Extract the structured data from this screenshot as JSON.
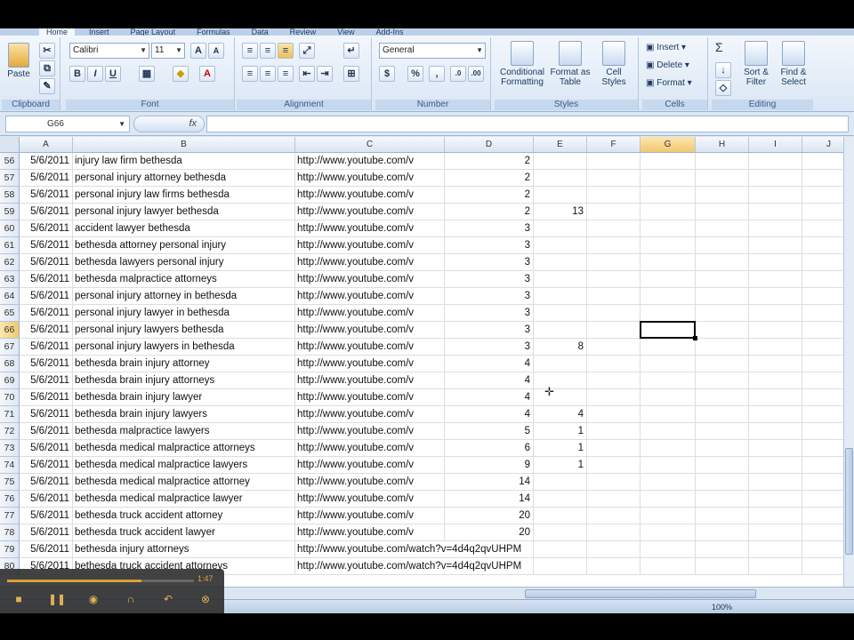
{
  "ribbon": {
    "tabs": [
      "Home",
      "Insert",
      "Page Layout",
      "Formulas",
      "Data",
      "Review",
      "View",
      "Add-Ins"
    ],
    "active_tab": "Home",
    "clipboard": {
      "paste": "Paste",
      "label": "Clipboard"
    },
    "font": {
      "name": "Calibri",
      "size": "11",
      "label": "Font",
      "bold": "B",
      "italic": "I",
      "underline": "U"
    },
    "alignment": {
      "label": "Alignment"
    },
    "number": {
      "format": "General",
      "label": "Number",
      "currency": "$",
      "percent": "%",
      "comma": ",",
      "inc_decimal": ".0",
      "dec_decimal": ".00"
    },
    "styles": {
      "conditional": "Conditional Formatting",
      "format_table": "Format as Table",
      "cell_styles": "Cell Styles",
      "label": "Styles"
    },
    "cells": {
      "insert": "Insert",
      "delete": "Delete",
      "format": "Format",
      "label": "Cells"
    },
    "editing": {
      "sum": "Σ",
      "sort_filter": "Sort & Filter",
      "find_select": "Find & Select",
      "label": "Editing"
    }
  },
  "formula_bar": {
    "name_box": "G66",
    "fx": "fx",
    "value": ""
  },
  "columns": [
    "A",
    "B",
    "C",
    "D",
    "E",
    "F",
    "G",
    "H",
    "I",
    "J"
  ],
  "selected_column": "G",
  "selected_row": "66",
  "rows": [
    {
      "n": "56",
      "a": "5/6/2011",
      "b": "injury law firm bethesda",
      "c": "http://www.youtube.com/v",
      "d": "2",
      "e": ""
    },
    {
      "n": "57",
      "a": "5/6/2011",
      "b": "personal injury attorney bethesda",
      "c": "http://www.youtube.com/v",
      "d": "2",
      "e": ""
    },
    {
      "n": "58",
      "a": "5/6/2011",
      "b": "personal injury law firms bethesda",
      "c": "http://www.youtube.com/v",
      "d": "2",
      "e": ""
    },
    {
      "n": "59",
      "a": "5/6/2011",
      "b": "personal injury lawyer bethesda",
      "c": "http://www.youtube.com/v",
      "d": "2",
      "e": "13"
    },
    {
      "n": "60",
      "a": "5/6/2011",
      "b": "accident lawyer bethesda",
      "c": "http://www.youtube.com/v",
      "d": "3",
      "e": ""
    },
    {
      "n": "61",
      "a": "5/6/2011",
      "b": "bethesda attorney personal injury",
      "c": "http://www.youtube.com/v",
      "d": "3",
      "e": ""
    },
    {
      "n": "62",
      "a": "5/6/2011",
      "b": "bethesda lawyers personal injury",
      "c": "http://www.youtube.com/v",
      "d": "3",
      "e": ""
    },
    {
      "n": "63",
      "a": "5/6/2011",
      "b": "bethesda malpractice attorneys",
      "c": "http://www.youtube.com/v",
      "d": "3",
      "e": ""
    },
    {
      "n": "64",
      "a": "5/6/2011",
      "b": "personal injury attorney in bethesda",
      "c": "http://www.youtube.com/v",
      "d": "3",
      "e": ""
    },
    {
      "n": "65",
      "a": "5/6/2011",
      "b": "personal injury lawyer in bethesda",
      "c": "http://www.youtube.com/v",
      "d": "3",
      "e": ""
    },
    {
      "n": "66",
      "a": "5/6/2011",
      "b": "personal injury lawyers bethesda",
      "c": "http://www.youtube.com/v",
      "d": "3",
      "e": ""
    },
    {
      "n": "67",
      "a": "5/6/2011",
      "b": "personal injury lawyers in bethesda",
      "c": "http://www.youtube.com/v",
      "d": "3",
      "e": "8"
    },
    {
      "n": "68",
      "a": "5/6/2011",
      "b": "bethesda brain injury attorney",
      "c": "http://www.youtube.com/v",
      "d": "4",
      "e": ""
    },
    {
      "n": "69",
      "a": "5/6/2011",
      "b": "bethesda brain injury attorneys",
      "c": "http://www.youtube.com/v",
      "d": "4",
      "e": ""
    },
    {
      "n": "70",
      "a": "5/6/2011",
      "b": "bethesda brain injury lawyer",
      "c": "http://www.youtube.com/v",
      "d": "4",
      "e": ""
    },
    {
      "n": "71",
      "a": "5/6/2011",
      "b": "bethesda brain injury lawyers",
      "c": "http://www.youtube.com/v",
      "d": "4",
      "e": "4"
    },
    {
      "n": "72",
      "a": "5/6/2011",
      "b": "bethesda malpractice lawyers",
      "c": "http://www.youtube.com/v",
      "d": "5",
      "e": "1"
    },
    {
      "n": "73",
      "a": "5/6/2011",
      "b": "bethesda medical malpractice attorneys",
      "c": "http://www.youtube.com/v",
      "d": "6",
      "e": "1"
    },
    {
      "n": "74",
      "a": "5/6/2011",
      "b": "bethesda medical malpractice lawyers",
      "c": "http://www.youtube.com/v",
      "d": "9",
      "e": "1"
    },
    {
      "n": "75",
      "a": "5/6/2011",
      "b": "bethesda medical malpractice attorney",
      "c": "http://www.youtube.com/v",
      "d": "14",
      "e": ""
    },
    {
      "n": "76",
      "a": "5/6/2011",
      "b": "bethesda medical malpractice lawyer",
      "c": "http://www.youtube.com/v",
      "d": "14",
      "e": ""
    },
    {
      "n": "77",
      "a": "5/6/2011",
      "b": "bethesda truck accident attorney",
      "c": "http://www.youtube.com/v",
      "d": "20",
      "e": ""
    },
    {
      "n": "78",
      "a": "5/6/2011",
      "b": "bethesda truck accident lawyer",
      "c": "http://www.youtube.com/v",
      "d": "20",
      "e": ""
    },
    {
      "n": "79",
      "a": "5/6/2011",
      "b": "bethesda injury attorneys",
      "c": "http://www.youtube.com/watch?v=4d4q2qvUHPM",
      "d": "",
      "e": "",
      "c_overflow": true
    },
    {
      "n": "80",
      "a": "5/6/2011",
      "b": "bethesda truck accident attorneys",
      "c": "http://www.youtube.com/watch?v=4d4q2qvUHPM",
      "d": "",
      "e": "",
      "c_overflow": true
    }
  ],
  "status": {
    "zoom": "100%"
  },
  "player": {
    "time": "1:47",
    "progress": 0.72
  },
  "colors": {
    "accent": "#f3c770",
    "ribbon": "#dbe5f1",
    "player": "#d9a23a"
  }
}
